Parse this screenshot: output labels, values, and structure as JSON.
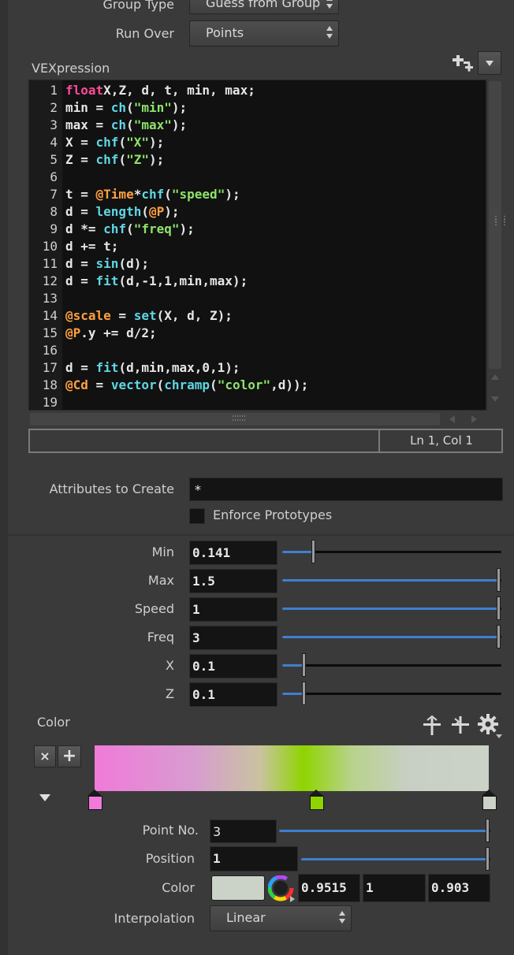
{
  "group_type": {
    "label": "Group Type",
    "value": "Guess from Group"
  },
  "run_over": {
    "label": "Run Over",
    "value": "Points"
  },
  "vexpression": {
    "label": "VEXpression",
    "lines": [
      {
        "n": "1",
        "segs": [
          [
            "kw",
            "float"
          ],
          [
            "",
            "X,Z, d, t, min, max;"
          ]
        ]
      },
      {
        "n": "2",
        "segs": [
          [
            "",
            "min = "
          ],
          [
            "fn",
            "ch"
          ],
          [
            "",
            "("
          ],
          [
            "str",
            "\"min\""
          ],
          [
            "",
            ");"
          ]
        ]
      },
      {
        "n": "3",
        "segs": [
          [
            "",
            "max = "
          ],
          [
            "fn",
            "ch"
          ],
          [
            "",
            "("
          ],
          [
            "str",
            "\"max\""
          ],
          [
            "",
            ");"
          ]
        ]
      },
      {
        "n": "4",
        "segs": [
          [
            "",
            "X = "
          ],
          [
            "fn",
            "chf"
          ],
          [
            "",
            "("
          ],
          [
            "str",
            "\"X\""
          ],
          [
            "",
            ");"
          ]
        ]
      },
      {
        "n": "5",
        "segs": [
          [
            "",
            "Z = "
          ],
          [
            "fn",
            "chf"
          ],
          [
            "",
            "("
          ],
          [
            "str",
            "\"Z\""
          ],
          [
            "",
            ");"
          ]
        ]
      },
      {
        "n": "6",
        "segs": []
      },
      {
        "n": "7",
        "segs": [
          [
            "",
            "t = "
          ],
          [
            "attr",
            "@Time"
          ],
          [
            "",
            "*"
          ],
          [
            "fn",
            "chf"
          ],
          [
            "",
            "("
          ],
          [
            "str",
            "\"speed\""
          ],
          [
            "",
            ");"
          ]
        ]
      },
      {
        "n": "8",
        "segs": [
          [
            "",
            "d = "
          ],
          [
            "fn",
            "length"
          ],
          [
            "",
            "("
          ],
          [
            "attr",
            "@P"
          ],
          [
            "",
            ");"
          ]
        ]
      },
      {
        "n": "9",
        "segs": [
          [
            "",
            "d *= "
          ],
          [
            "fn",
            "chf"
          ],
          [
            "",
            "("
          ],
          [
            "str",
            "\"freq\""
          ],
          [
            "",
            ");"
          ]
        ]
      },
      {
        "n": "10",
        "segs": [
          [
            "",
            "d += t;"
          ]
        ]
      },
      {
        "n": "11",
        "segs": [
          [
            "",
            "d = "
          ],
          [
            "fn",
            "sin"
          ],
          [
            "",
            "(d);"
          ]
        ]
      },
      {
        "n": "12",
        "segs": [
          [
            "",
            "d = "
          ],
          [
            "fn",
            "fit"
          ],
          [
            "",
            "(d,-1,1,min,max);"
          ]
        ]
      },
      {
        "n": "13",
        "segs": []
      },
      {
        "n": "14",
        "segs": [
          [
            "attr",
            "@scale"
          ],
          [
            "",
            " = "
          ],
          [
            "fn",
            "set"
          ],
          [
            "",
            "(X, d, Z);"
          ]
        ]
      },
      {
        "n": "15",
        "segs": [
          [
            "attr",
            "@P"
          ],
          [
            "",
            ".y += d/2;"
          ]
        ]
      },
      {
        "n": "16",
        "segs": []
      },
      {
        "n": "17",
        "segs": [
          [
            "",
            "d = "
          ],
          [
            "fn",
            "fit"
          ],
          [
            "",
            "(d,min,max,0,1);"
          ]
        ]
      },
      {
        "n": "18",
        "segs": [
          [
            "attr",
            "@Cd"
          ],
          [
            "",
            " = "
          ],
          [
            "fn",
            "vector"
          ],
          [
            "",
            "("
          ],
          [
            "fn",
            "chramp"
          ],
          [
            "",
            "("
          ],
          [
            "str",
            "\"color\""
          ],
          [
            "",
            ",d));"
          ]
        ]
      },
      {
        "n": "19",
        "segs": []
      }
    ],
    "status": "Ln 1, Col 1"
  },
  "attributes": {
    "label": "Attributes to Create",
    "value": "*"
  },
  "enforce": {
    "label": "Enforce Prototypes"
  },
  "params": [
    {
      "label": "Min",
      "value": "0.141",
      "level": 0.141
    },
    {
      "label": "Max",
      "value": "1.5",
      "level": 1.0
    },
    {
      "label": "Speed",
      "value": "1",
      "level": 1.0
    },
    {
      "label": "Freq",
      "value": "3",
      "level": 1.0
    },
    {
      "label": "X",
      "value": "0.1",
      "level": 0.1
    },
    {
      "label": "Z",
      "value": "0.1",
      "level": 0.1
    }
  ],
  "color_ramp": {
    "label": "Color",
    "delete_label": "×",
    "add_label": "+",
    "keys": [
      {
        "color": "#f07ad9",
        "position": 0.0
      },
      {
        "color": "#8fd400",
        "position": 0.5627
      },
      {
        "color": "#cbd2c8",
        "position": 1.0
      }
    ]
  },
  "point_no": {
    "label": "Point No.",
    "value": "3",
    "level": 1.0
  },
  "position": {
    "label": "Position",
    "value": "1",
    "level": 1.0
  },
  "color_field": {
    "label": "Color",
    "swatch": "#cbd2c8",
    "r": "0.9515",
    "g": "1",
    "b": "0.903"
  },
  "interpolation": {
    "label": "Interpolation",
    "value": "Linear"
  }
}
